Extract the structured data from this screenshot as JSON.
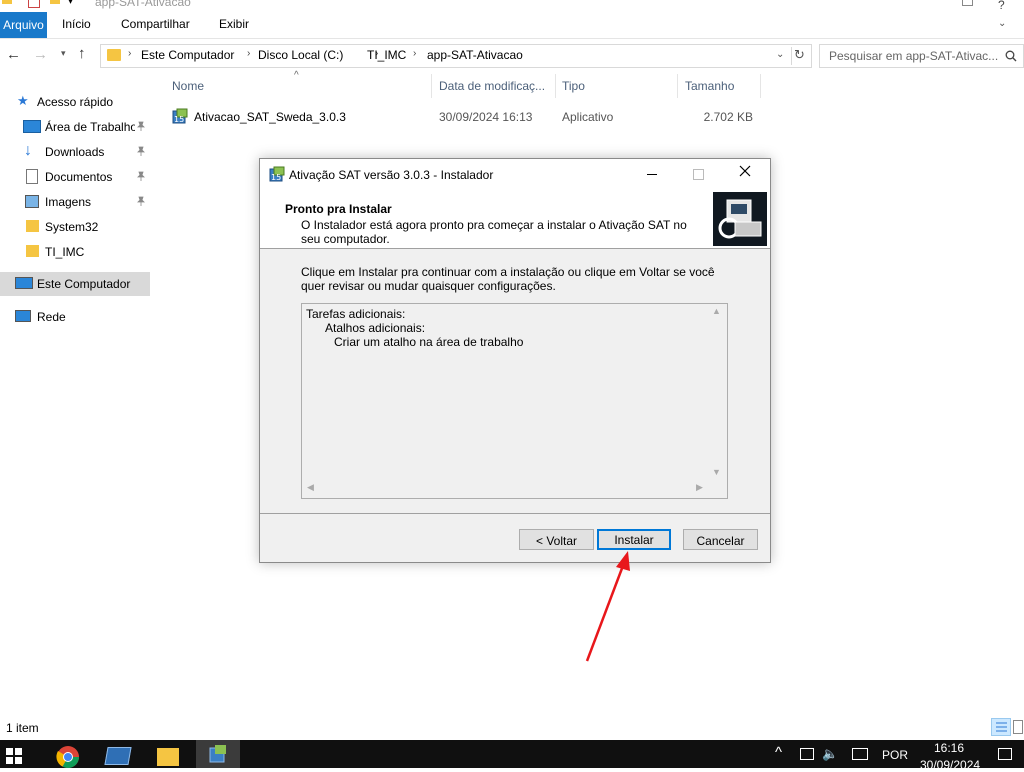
{
  "window": {
    "title": "app-SAT-Ativacao"
  },
  "ribbon": {
    "file_tab": "Arquivo",
    "tabs": [
      "Início",
      "Compartilhar",
      "Exibir"
    ]
  },
  "address": {
    "crumbs": [
      "Este Computador",
      "Disco Local (C:)",
      "TI_IMC",
      "app-SAT-Ativacao"
    ],
    "search_placeholder": "Pesquisar em app-SAT-Ativac..."
  },
  "sidebar": {
    "items": [
      {
        "label": "Acesso rápido",
        "icon": "star-icon"
      },
      {
        "label": "Área de Trabalho",
        "icon": "desktop-icon",
        "pinned": true
      },
      {
        "label": "Downloads",
        "icon": "download-icon",
        "pinned": true
      },
      {
        "label": "Documentos",
        "icon": "document-icon",
        "pinned": true
      },
      {
        "label": "Imagens",
        "icon": "images-icon",
        "pinned": true
      },
      {
        "label": "System32",
        "icon": "folder-icon"
      },
      {
        "label": "TI_IMC",
        "icon": "folder-icon"
      },
      {
        "label": "Este Computador",
        "icon": "computer-icon",
        "selected": true
      },
      {
        "label": "Rede",
        "icon": "network-icon"
      }
    ]
  },
  "file_list": {
    "columns": [
      "Nome",
      "Data de modificaç...",
      "Tipo",
      "Tamanho"
    ],
    "rows": [
      {
        "name": "Ativacao_SAT_Sweda_3.0.3",
        "modified": "30/09/2024 16:13",
        "type": "Aplicativo",
        "size": "2.702 KB"
      }
    ]
  },
  "status_bar": {
    "item_count": "1 item"
  },
  "dialog": {
    "title": "Ativação SAT versão 3.0.3 - Instalador",
    "header_title": "Pronto pra Instalar",
    "header_subtitle": "O Instalador está agora pronto pra começar a instalar o Ativação SAT no seu computador.",
    "body_text": "Clique em Instalar pra continuar com a instalação ou clique em Voltar se você quer revisar ou mudar quaisquer configurações.",
    "memo_lines": [
      "Tarefas adicionais:",
      "Atalhos adicionais:",
      "Criar um atalho na área de trabalho"
    ],
    "buttons": {
      "back": "< Voltar",
      "install": "Instalar",
      "cancel": "Cancelar"
    }
  },
  "taskbar": {
    "tray_language": "POR",
    "clock_time": "16:16",
    "clock_date": "30/09/2024"
  },
  "colors": {
    "accent": "#0078d7",
    "ribbon_file": "#1979ca",
    "annotation_arrow": "#e8171b",
    "selection": "#cce8ff"
  }
}
